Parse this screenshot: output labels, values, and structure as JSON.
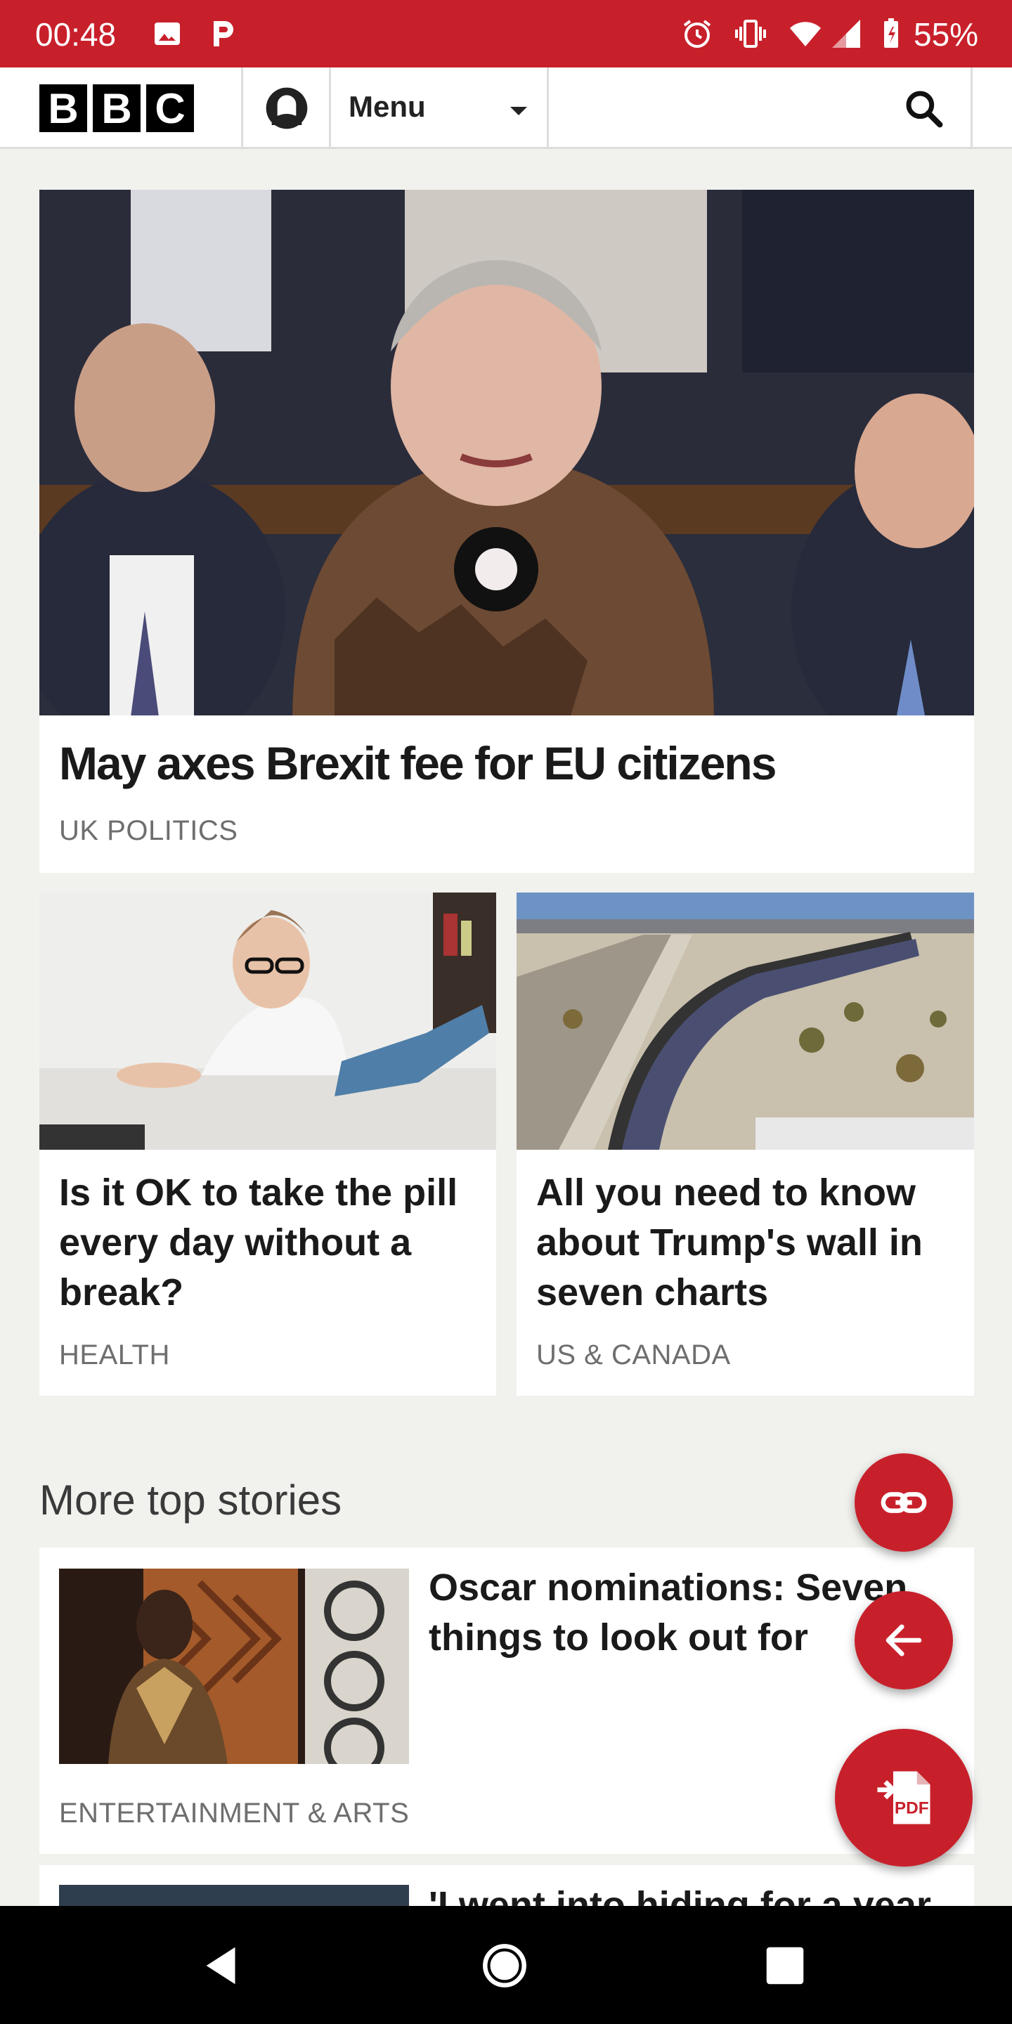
{
  "status_bar": {
    "time": "00:48",
    "battery": "55%",
    "icons": [
      "image-icon",
      "p-app-icon",
      "alarm-icon",
      "vibrate-icon",
      "wifi-icon",
      "signal-icon",
      "battery-icon"
    ]
  },
  "header": {
    "logo_letters": [
      "B",
      "B",
      "C"
    ],
    "menu_label": "Menu"
  },
  "lead_story": {
    "headline": "May axes Brexit fee for EU citizens",
    "section": "UK POLITICS"
  },
  "secondary_stories": [
    {
      "headline_lines": [
        "Is it OK to take the pill",
        "every day without a",
        "break?"
      ],
      "section": "HEALTH"
    },
    {
      "headline_lines": [
        "All you need to know",
        "about Trump's wall in",
        "seven charts"
      ],
      "section": "US & CANADA"
    }
  ],
  "more_top_stories": {
    "title": "More top stories",
    "items": [
      {
        "headline_lines": [
          "Oscar nominations: Seven",
          "things to look out for"
        ],
        "section": "ENTERTAINMENT & ARTS"
      },
      {
        "headline_lines": [
          "'I went into hiding for a year"
        ]
      }
    ]
  },
  "fab": {
    "pdf_label": "PDF"
  },
  "colors": {
    "bbc_red": "#c8202b",
    "page_bg": "#f1f1ee"
  }
}
